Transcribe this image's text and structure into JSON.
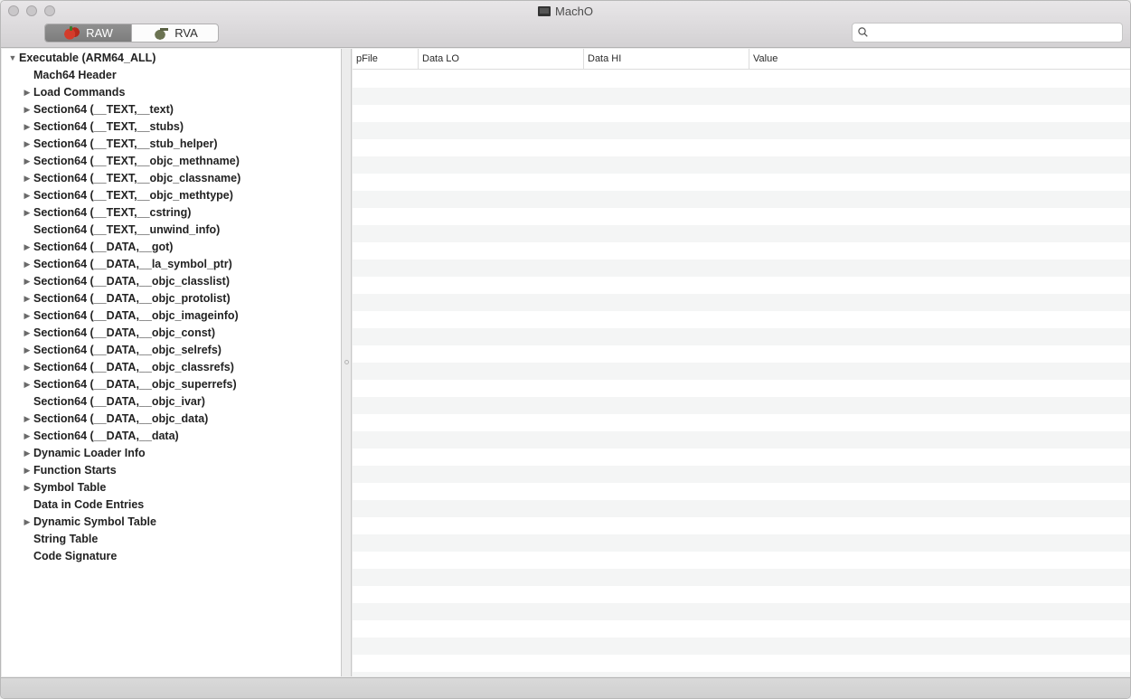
{
  "window": {
    "title": "MachO"
  },
  "toolbar": {
    "modes": [
      {
        "label": "RAW",
        "icon": "raw-mode-icon",
        "active": true
      },
      {
        "label": "RVA",
        "icon": "rva-mode-icon",
        "active": false
      }
    ],
    "search": {
      "value": "",
      "placeholder": ""
    }
  },
  "tree": {
    "root": {
      "label": "Executable  (ARM64_ALL)",
      "expanded": true
    },
    "items": [
      {
        "label": "Mach64 Header",
        "expandable": false
      },
      {
        "label": "Load Commands",
        "expandable": true
      },
      {
        "label": "Section64 (__TEXT,__text)",
        "expandable": true
      },
      {
        "label": "Section64 (__TEXT,__stubs)",
        "expandable": true
      },
      {
        "label": "Section64 (__TEXT,__stub_helper)",
        "expandable": true
      },
      {
        "label": "Section64 (__TEXT,__objc_methname)",
        "expandable": true
      },
      {
        "label": "Section64 (__TEXT,__objc_classname)",
        "expandable": true
      },
      {
        "label": "Section64 (__TEXT,__objc_methtype)",
        "expandable": true
      },
      {
        "label": "Section64 (__TEXT,__cstring)",
        "expandable": true
      },
      {
        "label": "Section64 (__TEXT,__unwind_info)",
        "expandable": false
      },
      {
        "label": "Section64 (__DATA,__got)",
        "expandable": true
      },
      {
        "label": "Section64 (__DATA,__la_symbol_ptr)",
        "expandable": true
      },
      {
        "label": "Section64 (__DATA,__objc_classlist)",
        "expandable": true
      },
      {
        "label": "Section64 (__DATA,__objc_protolist)",
        "expandable": true
      },
      {
        "label": "Section64 (__DATA,__objc_imageinfo)",
        "expandable": true
      },
      {
        "label": "Section64 (__DATA,__objc_const)",
        "expandable": true
      },
      {
        "label": "Section64 (__DATA,__objc_selrefs)",
        "expandable": true
      },
      {
        "label": "Section64 (__DATA,__objc_classrefs)",
        "expandable": true
      },
      {
        "label": "Section64 (__DATA,__objc_superrefs)",
        "expandable": true
      },
      {
        "label": "Section64 (__DATA,__objc_ivar)",
        "expandable": false
      },
      {
        "label": "Section64 (__DATA,__objc_data)",
        "expandable": true
      },
      {
        "label": "Section64 (__DATA,__data)",
        "expandable": true
      },
      {
        "label": "Dynamic Loader Info",
        "expandable": true
      },
      {
        "label": "Function Starts",
        "expandable": true
      },
      {
        "label": "Symbol Table",
        "expandable": true
      },
      {
        "label": "Data in Code Entries",
        "expandable": false
      },
      {
        "label": "Dynamic Symbol Table",
        "expandable": true
      },
      {
        "label": "String Table",
        "expandable": false
      },
      {
        "label": "Code Signature",
        "expandable": false
      }
    ]
  },
  "table": {
    "columns": [
      "pFile",
      "Data LO",
      "Data HI",
      "Value"
    ],
    "rows": []
  }
}
